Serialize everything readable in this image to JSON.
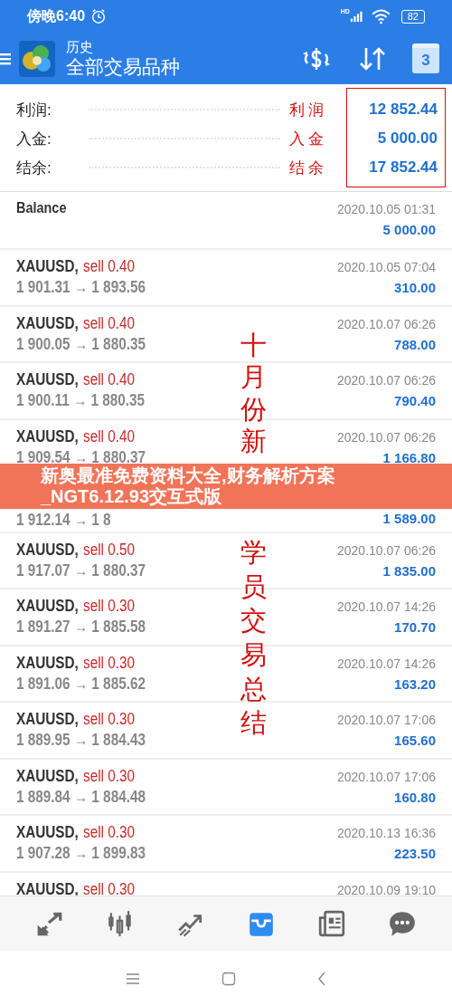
{
  "status_bar": {
    "time": "傍晚6:40",
    "signal_label": "HD",
    "battery": "82"
  },
  "header": {
    "subtitle": "历史",
    "title": "全部交易品种",
    "calendar_day": "3"
  },
  "summary": [
    {
      "label": "利润:",
      "value": "12 852.44",
      "note": "利润"
    },
    {
      "label": "入金:",
      "value": "5 000.00",
      "note": "入金"
    },
    {
      "label": "结余:",
      "value": "17 852.44",
      "note": "结余"
    }
  ],
  "rows": [
    {
      "kind": "balance",
      "symbol": "Balance",
      "time": "2020.10.05 01:31",
      "profit": "5 000.00"
    },
    {
      "kind": "trade",
      "symbol": "XAUUSD,",
      "trade": "sell 0.40",
      "prices": "1 901.31 → 1 893.56",
      "time": "2020.10.05 07:04",
      "profit": "310.00"
    },
    {
      "kind": "trade",
      "symbol": "XAUUSD,",
      "trade": "sell 0.40",
      "prices": "1 900.05 → 1 880.35",
      "time": "2020.10.07 06:26",
      "profit": "788.00"
    },
    {
      "kind": "trade",
      "symbol": "XAUUSD,",
      "trade": "sell 0.40",
      "prices": "1 900.11 → 1 880.35",
      "time": "2020.10.07 06:26",
      "profit": "790.40"
    },
    {
      "kind": "trade",
      "symbol": "XAUUSD,",
      "trade": "sell 0.40",
      "prices": "1 909.54 → 1 880.37",
      "time": "2020.10.07 06:26",
      "profit": "1 166.80"
    },
    {
      "kind": "trade",
      "prices": "1 912.14 → 1 8",
      "profit": "1 589.00"
    },
    {
      "kind": "trade",
      "symbol": "XAUUSD,",
      "trade": "sell 0.50",
      "prices": "1 917.07 → 1 880.37",
      "time": "2020.10.07 06:26",
      "profit": "1 835.00"
    },
    {
      "kind": "trade",
      "symbol": "XAUUSD,",
      "trade": "sell 0.30",
      "prices": "1 891.27 → 1 885.58",
      "time": "2020.10.07 14:26",
      "profit": "170.70"
    },
    {
      "kind": "trade",
      "symbol": "XAUUSD,",
      "trade": "sell 0.30",
      "prices": "1 891.06 → 1 885.62",
      "time": "2020.10.07 14:26",
      "profit": "163.20"
    },
    {
      "kind": "trade",
      "symbol": "XAUUSD,",
      "trade": "sell 0.30",
      "prices": "1 889.95 → 1 884.43",
      "time": "2020.10.07 17:06",
      "profit": "165.60"
    },
    {
      "kind": "trade",
      "symbol": "XAUUSD,",
      "trade": "sell 0.30",
      "prices": "1 889.84 → 1 884.48",
      "time": "2020.10.07 17:06",
      "profit": "160.80"
    },
    {
      "kind": "trade",
      "symbol": "XAUUSD,",
      "trade": "sell 0.30",
      "prices": "1 907.28 → 1 899.83",
      "time": "2020.10.13 16:36",
      "profit": "223.50"
    },
    {
      "kind": "trade",
      "symbol": "XAUUSD,",
      "trade": "sell 0.30",
      "time": "2020.10.09 19:10"
    }
  ],
  "annotation_vertical": [
    "十月份新",
    "学员交易总结"
  ],
  "banner": "新奥最准免费资料大全,财务解析方案_NGT6.12.93交互式版",
  "bottom_nav": [
    {
      "kind": "quotes",
      "selected": false
    },
    {
      "kind": "chart",
      "selected": false
    },
    {
      "kind": "trade",
      "selected": false
    },
    {
      "kind": "history",
      "selected": true
    },
    {
      "kind": "news",
      "selected": false
    },
    {
      "kind": "chat",
      "selected": false
    }
  ]
}
